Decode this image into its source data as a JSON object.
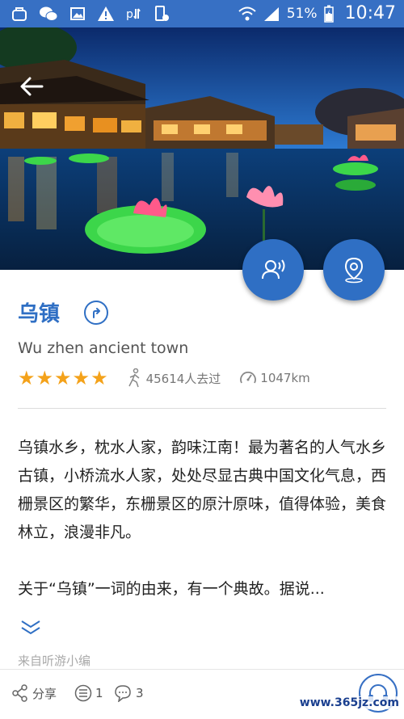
{
  "status_bar": {
    "battery": "51%",
    "time": "10:47"
  },
  "place": {
    "name": "乌镇",
    "english_name": "Wu zhen ancient town",
    "rating_stars": 5,
    "visitors": "45614人去过",
    "distance": "1047km"
  },
  "description": {
    "paragraph1": "乌镇水乡，枕水人家，韵味江南！最为著名的人气水乡古镇，小桥流水人家，处处尽显古典中国文化气息，西栅景区的繁华，东栅景区的原汁原味，值得体验，美食林立，浪漫非凡。",
    "paragraph2": "关于“乌镇”一词的由来，有一个典故。据说..."
  },
  "source": "来自听游小编",
  "bottom_bar": {
    "share_label": "分享",
    "list_count": "1",
    "comment_count": "3"
  },
  "watermark": "www.365jz.com",
  "colors": {
    "primary": "#2f6fc4",
    "star": "#f4a21a",
    "statusbar": "#3770c4"
  }
}
